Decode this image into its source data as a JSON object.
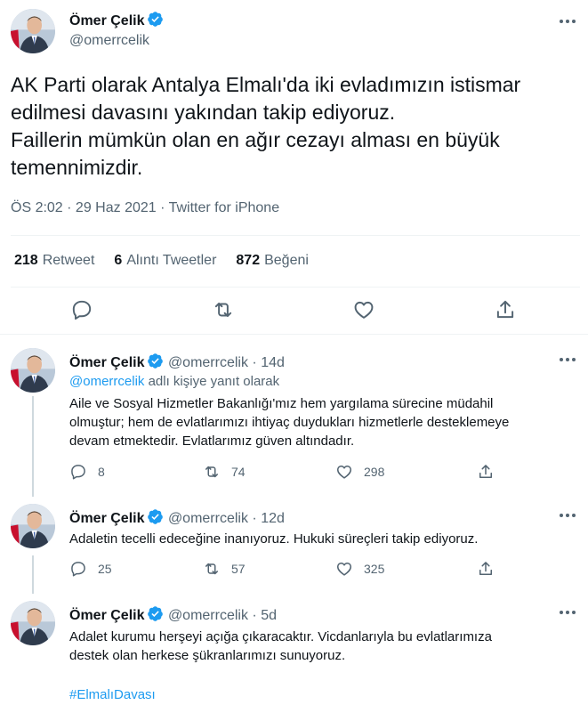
{
  "colors": {
    "accent": "#1d9bf0",
    "muted": "#536471",
    "text": "#0f1419"
  },
  "main": {
    "name": "Ömer Çelik",
    "handle": "@omerrcelik",
    "text_lines": [
      "AK Parti olarak Antalya Elmalı'da iki evladımızın istismar",
      "edilmesi davasını yakından takip ediyoruz.",
      "Faillerin mümkün olan en ağır cezayı alması en büyük",
      "temennimizdir."
    ],
    "meta": "ÖS 2:02 · 29 Haz 2021 · Twitter for iPhone",
    "stats": {
      "retweet_count": "218",
      "retweet_label": "Retweet",
      "quote_count": "6",
      "quote_label": "Alıntı Tweetler",
      "like_count": "872",
      "like_label": "Beğeni"
    }
  },
  "replies": [
    {
      "name": "Ömer Çelik",
      "handle": "@omerrcelik",
      "age": "· 14d",
      "reply_to_handle": "@omerrcelik",
      "reply_to_text": "adlı kişiye yanıt olarak",
      "text_lines": [
        "Aile ve Sosyal Hizmetler Bakanlığı'mız hem yargılama sürecine müdahil",
        "olmuştur; hem de evlatlarımızı ihtiyaç duydukları hizmetlerle desteklemeye",
        "devam etmektedir. Evlatlarımız güven altındadır."
      ],
      "replies": "8",
      "retweets": "74",
      "likes": "298"
    },
    {
      "name": "Ömer Çelik",
      "handle": "@omerrcelik",
      "age": "· 12d",
      "text_lines": [
        "Adaletin tecelli edeceğine inanıyoruz. Hukuki süreçleri takip ediyoruz."
      ],
      "replies": "25",
      "retweets": "57",
      "likes": "325"
    },
    {
      "name": "Ömer Çelik",
      "handle": "@omerrcelik",
      "age": "· 5d",
      "text_lines": [
        "Adalet kurumu herşeyi açığa çıkaracaktır. Vicdanlarıyla bu evlatlarımıza",
        "destek olan herkese şükranlarımızı sunuyoruz."
      ],
      "hashtag": "#ElmalıDavası"
    }
  ]
}
